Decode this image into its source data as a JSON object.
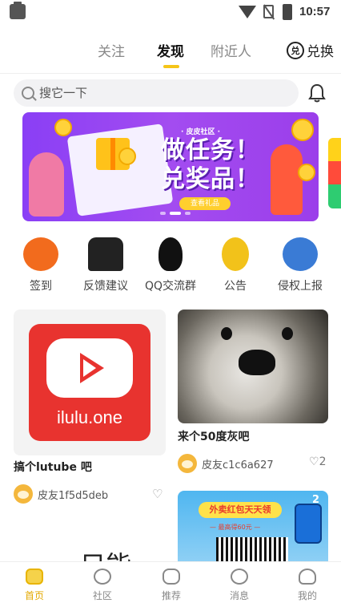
{
  "status_bar": {
    "time": "10:57"
  },
  "top_tabs": {
    "items": [
      "关注",
      "发现",
      "附近人"
    ],
    "active": "发现",
    "exchange_label": "兑换",
    "exchange_icon_text": "兑"
  },
  "search": {
    "placeholder": "搜它一下"
  },
  "banner": {
    "tag": "· 皮皮社区 ·",
    "headline_line1": "做任务！",
    "headline_line2": "兑奖品！",
    "cta": "查看礼品"
  },
  "quick_links": [
    {
      "label": "签到",
      "icon": "checkin-badge-icon",
      "color": "#f26b1d"
    },
    {
      "label": "反馈建议",
      "icon": "feedback-people-icon",
      "color": "#222222"
    },
    {
      "label": "QQ交流群",
      "icon": "qq-penguin-icon",
      "color": "#111111"
    },
    {
      "label": "公告",
      "icon": "announcement-megaphone-icon",
      "color": "#f2c21a"
    },
    {
      "label": "侵权上报",
      "icon": "report-cartoon-icon",
      "color": "#3a7bd5"
    }
  ],
  "feed": {
    "card1": {
      "image_text": "ilulu.one",
      "title": "搞个lutube 吧",
      "author": "皮友1f5d5deb",
      "partial_text": "只能"
    },
    "card2": {
      "title": "来个50度灰吧",
      "author": "皮友c1c6a627",
      "likes": "2"
    },
    "card3": {
      "headline": "外卖红包天天领",
      "sub": "— 最高得60元 —",
      "badge": "2"
    }
  },
  "bottom_nav": [
    {
      "label": "首页",
      "icon": "home-icon",
      "active": true
    },
    {
      "label": "社区",
      "icon": "planet-icon",
      "active": false
    },
    {
      "label": "推荐",
      "icon": "gamepad-icon",
      "active": false
    },
    {
      "label": "消息",
      "icon": "chat-bubble-icon",
      "active": false
    },
    {
      "label": "我的",
      "icon": "profile-icon",
      "active": false
    }
  ],
  "colors": {
    "accent": "#f5c518",
    "nav_active": "#e3a800",
    "banner_bg": "#9b3eea"
  }
}
